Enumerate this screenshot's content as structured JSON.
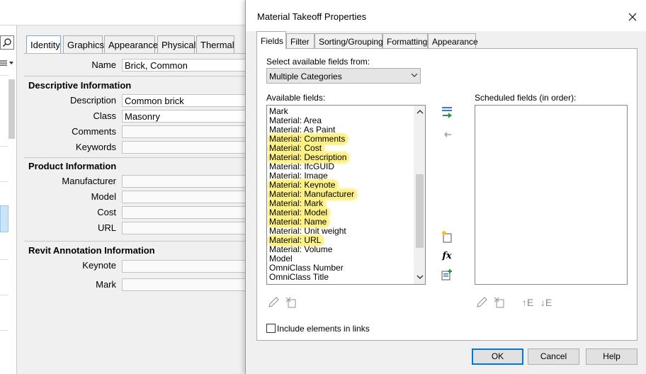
{
  "properties_panel": {
    "tabs": [
      "Identity",
      "Graphics",
      "Appearance",
      "Physical",
      "Thermal"
    ],
    "name_label": "Name",
    "name_value": "Brick, Common",
    "sections": {
      "descriptive": "Descriptive Information",
      "product": "Product Information",
      "annotation": "Revit Annotation Information"
    },
    "labels": {
      "description": "Description",
      "class": "Class",
      "comments": "Comments",
      "keywords": "Keywords",
      "manufacturer": "Manufacturer",
      "model": "Model",
      "cost": "Cost",
      "url": "URL",
      "keynote": "Keynote",
      "mark": "Mark"
    },
    "values": {
      "description": "Common brick",
      "class": "Masonry",
      "comments": "",
      "keywords": "",
      "manufacturer": "",
      "model": "",
      "cost": "",
      "url": "",
      "keynote": "",
      "mark": ""
    }
  },
  "dialog": {
    "title": "Material Takeoff Properties",
    "tabs": [
      "Fields",
      "Filter",
      "Sorting/Grouping",
      "Formatting",
      "Appearance"
    ],
    "select_from_label": "Select available fields from:",
    "select_from_value": "Multiple Categories",
    "available_label": "Available fields:",
    "scheduled_label": "Scheduled fields (in order):",
    "available_fields": [
      "Mark",
      "Material: Area",
      "Material: As Paint",
      "Material: Comments",
      "Material: Cost",
      "Material: Description",
      "Material: IfcGUID",
      "Material: Image",
      "Material: Keynote",
      "Material: Manufacturer",
      "Material: Mark",
      "Material: Model",
      "Material: Name",
      "Material: Unit weight",
      "Material: URL",
      "Material: Volume",
      "Model",
      "OmniClass Number",
      "OmniClass Title"
    ],
    "highlighted_fields": [
      "Material: Comments",
      "Material: Cost",
      "Material: Description",
      "Material: Keynote",
      "Material: Manufacturer",
      "Material: Mark",
      "Material: Model",
      "Material: Name",
      "Material: URL"
    ],
    "highlight_color": "#fdf087",
    "include_links_label": "Include elements in links",
    "include_links_checked": false,
    "buttons": {
      "ok": "OK",
      "cancel": "Cancel",
      "help": "Help"
    },
    "icons": {
      "add_parameter": "add-parameter-icon",
      "remove_parameter": "remove-parameter-icon",
      "new_parameter": "new-parameter-icon",
      "calculated_value": "fx",
      "combine_parameters": "combine-parameters-icon",
      "edit": "edit-icon",
      "delete": "delete-icon",
      "move_up": "↑E",
      "move_down": "↓E"
    }
  }
}
